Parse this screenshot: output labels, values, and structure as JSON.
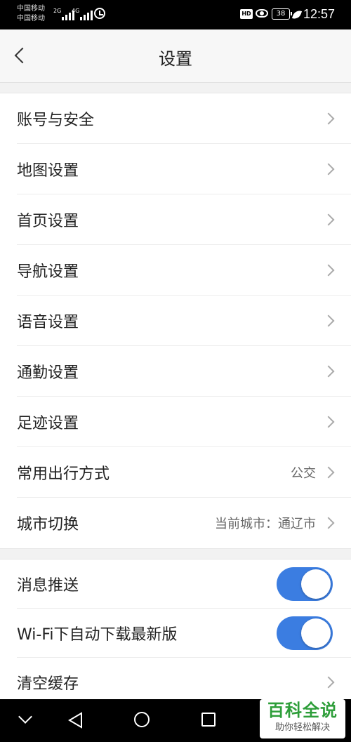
{
  "status_bar": {
    "carrier_1": "中国移动",
    "carrier_2": "中国移动",
    "signal_1_tag": "2G",
    "signal_2_tag": "4G",
    "hd_badge": "HD",
    "battery_level": "38",
    "time": "12:57"
  },
  "header": {
    "title": "设置"
  },
  "settings_group_1": [
    {
      "label": "账号与安全",
      "value": ""
    },
    {
      "label": "地图设置",
      "value": ""
    },
    {
      "label": "首页设置",
      "value": ""
    },
    {
      "label": "导航设置",
      "value": ""
    },
    {
      "label": "语音设置",
      "value": ""
    },
    {
      "label": "通勤设置",
      "value": ""
    },
    {
      "label": "足迹设置",
      "value": ""
    },
    {
      "label": "常用出行方式",
      "value": "公交"
    },
    {
      "label": "城市切换",
      "value": "当前城市：通辽市"
    }
  ],
  "settings_group_2": [
    {
      "label": "消息推送",
      "toggle": true
    },
    {
      "label": "Wi-Fi下自动下载最新版",
      "toggle": true
    },
    {
      "label": "清空缓存"
    }
  ],
  "watermark": {
    "title": "百科全说",
    "subtitle": "助你轻松解决"
  },
  "colors": {
    "toggle_on": "#3b7de1",
    "watermark_green": "#2e9e3a"
  }
}
